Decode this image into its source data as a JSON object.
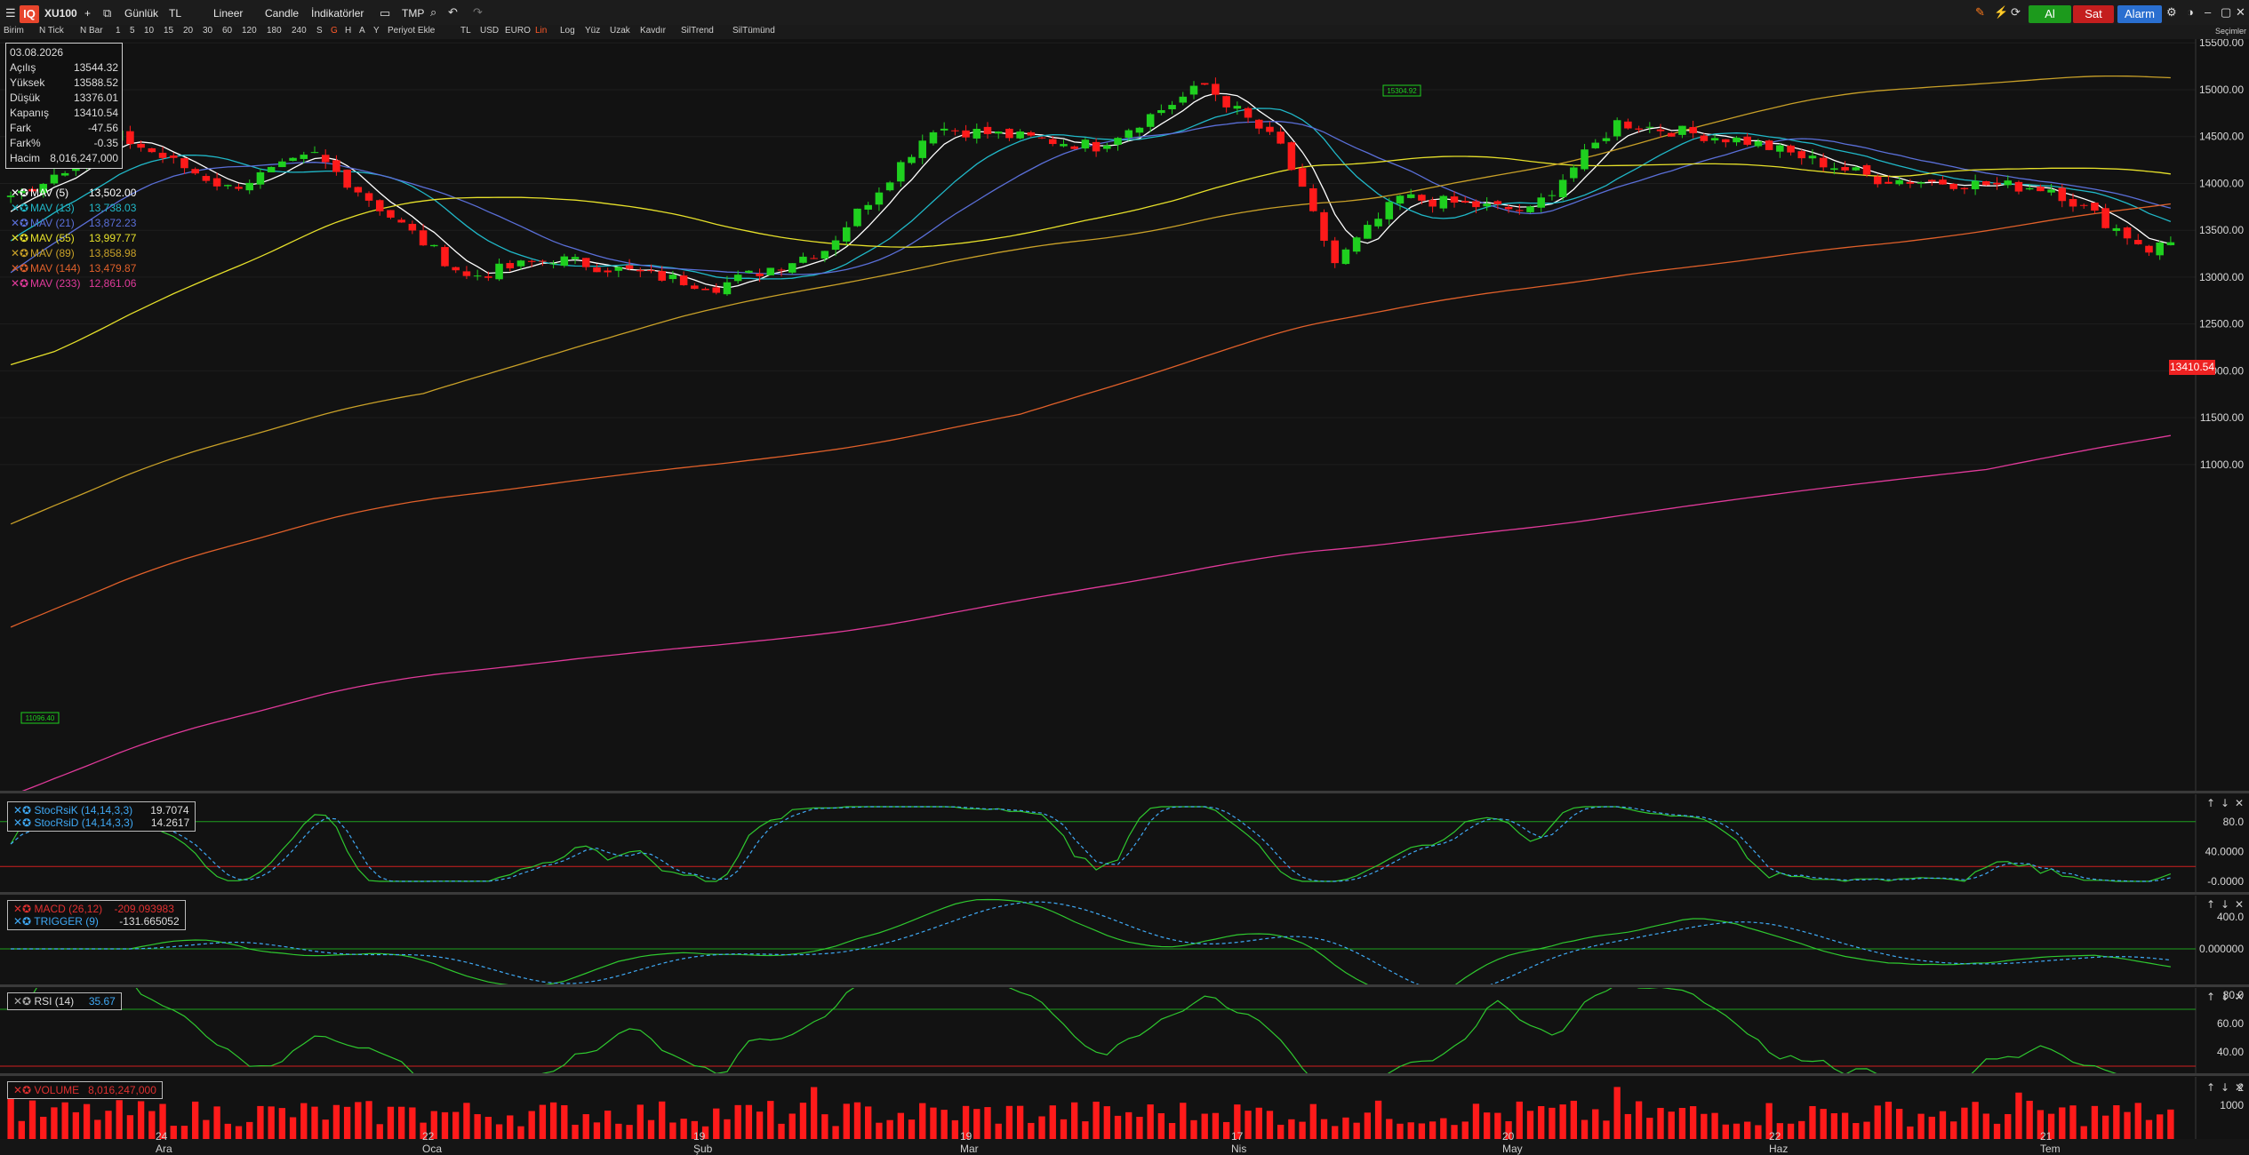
{
  "app": {
    "logo": "IQ"
  },
  "toolbar": {
    "symbol": "XU100",
    "plus": "+",
    "period": "Günlük",
    "currency": "TL",
    "scale": "Lineer",
    "chart_type": "Candle",
    "indicators": "İndikatörler",
    "template": "TMP",
    "buy_label": "Al",
    "sell_label": "Sat",
    "alarm_label": "Alarm"
  },
  "subtoolbar": {
    "items": [
      "Birim",
      "N Tick",
      "N Bar",
      "1",
      "5",
      "10",
      "15",
      "20",
      "30",
      "60",
      "120",
      "180",
      "240",
      "S",
      "G",
      "H",
      "A",
      "Y",
      "Periyot Ekle",
      "TL",
      "USD",
      "EURO",
      "Lin",
      "Log",
      "Yüz",
      "Uzak",
      "Kavdır",
      "SilTrend",
      "SilTümünd"
    ]
  },
  "top_right": {
    "label": "Seçimler"
  },
  "ohlc": {
    "date": "03.08.2026",
    "rows": [
      {
        "label": "Açılış",
        "value": "13544.32"
      },
      {
        "label": "Yüksek",
        "value": "13588.52"
      },
      {
        "label": "Düşük",
        "value": "13376.01"
      },
      {
        "label": "Kapanış",
        "value": "13410.54"
      },
      {
        "label": "Fark",
        "value": "-47.56"
      },
      {
        "label": "Fark%",
        "value": "-0.35"
      },
      {
        "label": "Hacim",
        "value": "8,016,247,000"
      }
    ]
  },
  "moving_averages": [
    {
      "label": "MAV (5)",
      "value": "13,502.00",
      "color": "#ffffff"
    },
    {
      "label": "MAV (13)",
      "value": "13,738.03",
      "color": "#20b8c8"
    },
    {
      "label": "MAV (21)",
      "value": "13,872.23",
      "color": "#5a6fd8"
    },
    {
      "label": "MAV (55)",
      "value": "13,997.77",
      "color": "#e6e02a"
    },
    {
      "label": "MAV (89)",
      "value": "13,858.98",
      "color": "#c8a028"
    },
    {
      "label": "MAV (144)",
      "value": "13,479.87",
      "color": "#e0602a"
    },
    {
      "label": "MAV (233)",
      "value": "12,861.06",
      "color": "#e03a9a"
    }
  ],
  "price_axis": {
    "ticks": [
      "15500.00",
      "15000.00",
      "14500.00",
      "14000.00",
      "13500.00",
      "13000.00",
      "12500.00",
      "12000.00",
      "11500.00",
      "11000.00"
    ],
    "last_price": "13410.54",
    "marker_label": "15304.92",
    "low_marker_label": "11096.40"
  },
  "x_axis": {
    "labels": [
      "24 Ara",
      "22 Oca",
      "19 Şub",
      "19 Mar",
      "17 Nis",
      "20 May",
      "22 Haz",
      "21 Tem"
    ]
  },
  "stoch": {
    "k_label": "StocRsiK (14,14,3,3)",
    "k_value": "19.7074",
    "d_label": "StocRsiD (14,14,3,3)",
    "d_value": "14.2617",
    "ticks": [
      "80.0",
      "40.0000",
      "-0.0000"
    ]
  },
  "macd": {
    "macd_label": "MACD (26,12)",
    "macd_value": "-209.093983",
    "trigger_label": "TRIGGER (9)",
    "trigger_value": "-131.665052",
    "ticks": [
      "400.0",
      "0.000000"
    ]
  },
  "rsi": {
    "label": "RSI (14)",
    "value": "35.67",
    "ticks": [
      "80.0",
      "60.00",
      "40.00"
    ]
  },
  "volume": {
    "label": "VOLUME",
    "value": "8,016,247,000",
    "ticks": [
      "2",
      "1000"
    ]
  },
  "colors": {
    "up": "#1fd01f",
    "down": "#ff1a1a",
    "bg": "#121212",
    "buy": "#1c9a1c",
    "sell": "#c41e1e",
    "alarm": "#2a6fd0"
  }
}
